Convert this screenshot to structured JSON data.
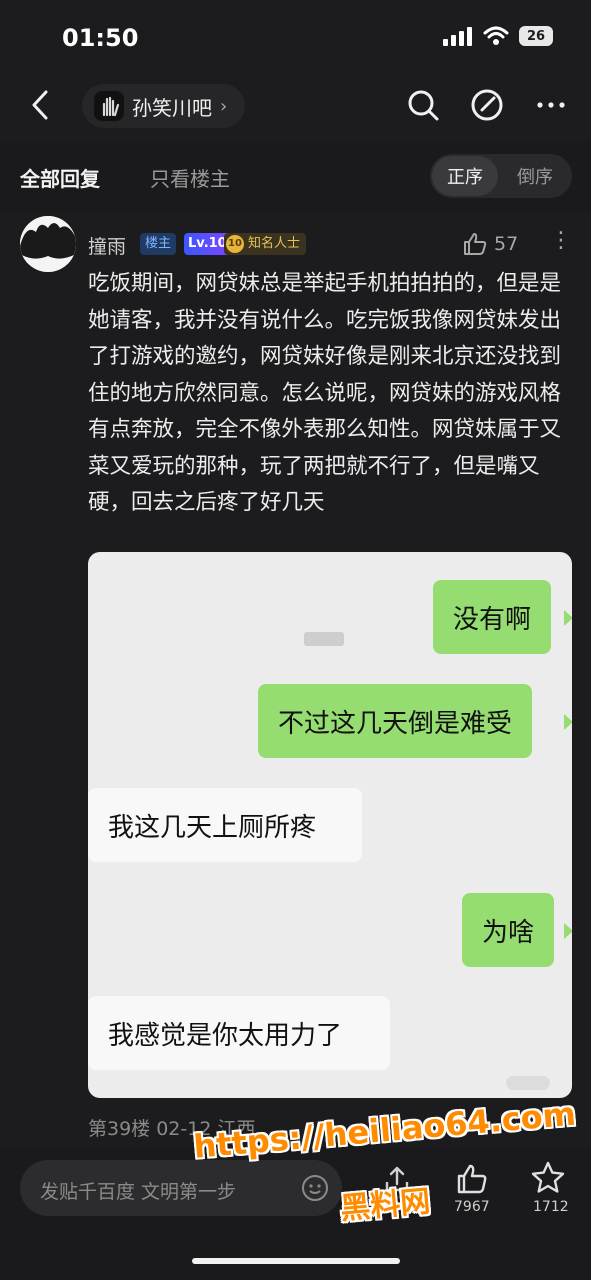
{
  "status_bar": {
    "time": "01:50",
    "battery": "26"
  },
  "nav": {
    "forum_name": "孙笑川吧",
    "forum_chevron": "›"
  },
  "tabs": {
    "all_replies": "全部回复",
    "only_op": "只看楼主",
    "sort_asc": "正序",
    "sort_desc": "倒序"
  },
  "post": {
    "username": "撞雨",
    "badge_op": "楼主",
    "badge_level": "Lv.10",
    "badge_fame": "知名人士",
    "badge_fame_coin": "10",
    "like_count": "57",
    "text": "吃饭期间，网贷妹总是举起手机拍拍拍的，但是是她请客，我并没有说什么。吃完饭我像网贷妹发出了打游戏的邀约，网贷妹好像是刚来北京还没找到住的地方欣然同意。怎么说呢，网贷妹的游戏风格有点奔放，完全不像外表那么知性。网贷妹属于又菜又爱玩的那种，玩了两把就不行了，但是嘴又硬，回去之后疼了好几天",
    "chat": [
      {
        "side": "right",
        "text": "没有啊"
      },
      {
        "side": "right",
        "text": "不过这几天倒是难受"
      },
      {
        "side": "left",
        "text": "我这几天上厕所疼"
      },
      {
        "side": "right",
        "text": "为啥"
      },
      {
        "side": "left",
        "text": "我感觉是你太用力了"
      }
    ],
    "floor_meta": "第39楼 02-12 江西"
  },
  "bottom_bar": {
    "reply_placeholder": "发贴千百度 文明第一步",
    "like_total": "7967",
    "favorite_total": "1712"
  },
  "watermark": {
    "url": "https://heiliao64.com",
    "name": "黑料网"
  },
  "colors": {
    "background": "#1c1c1e",
    "chat_green": "#95dc71",
    "watermark_orange": "#ff8c00"
  }
}
